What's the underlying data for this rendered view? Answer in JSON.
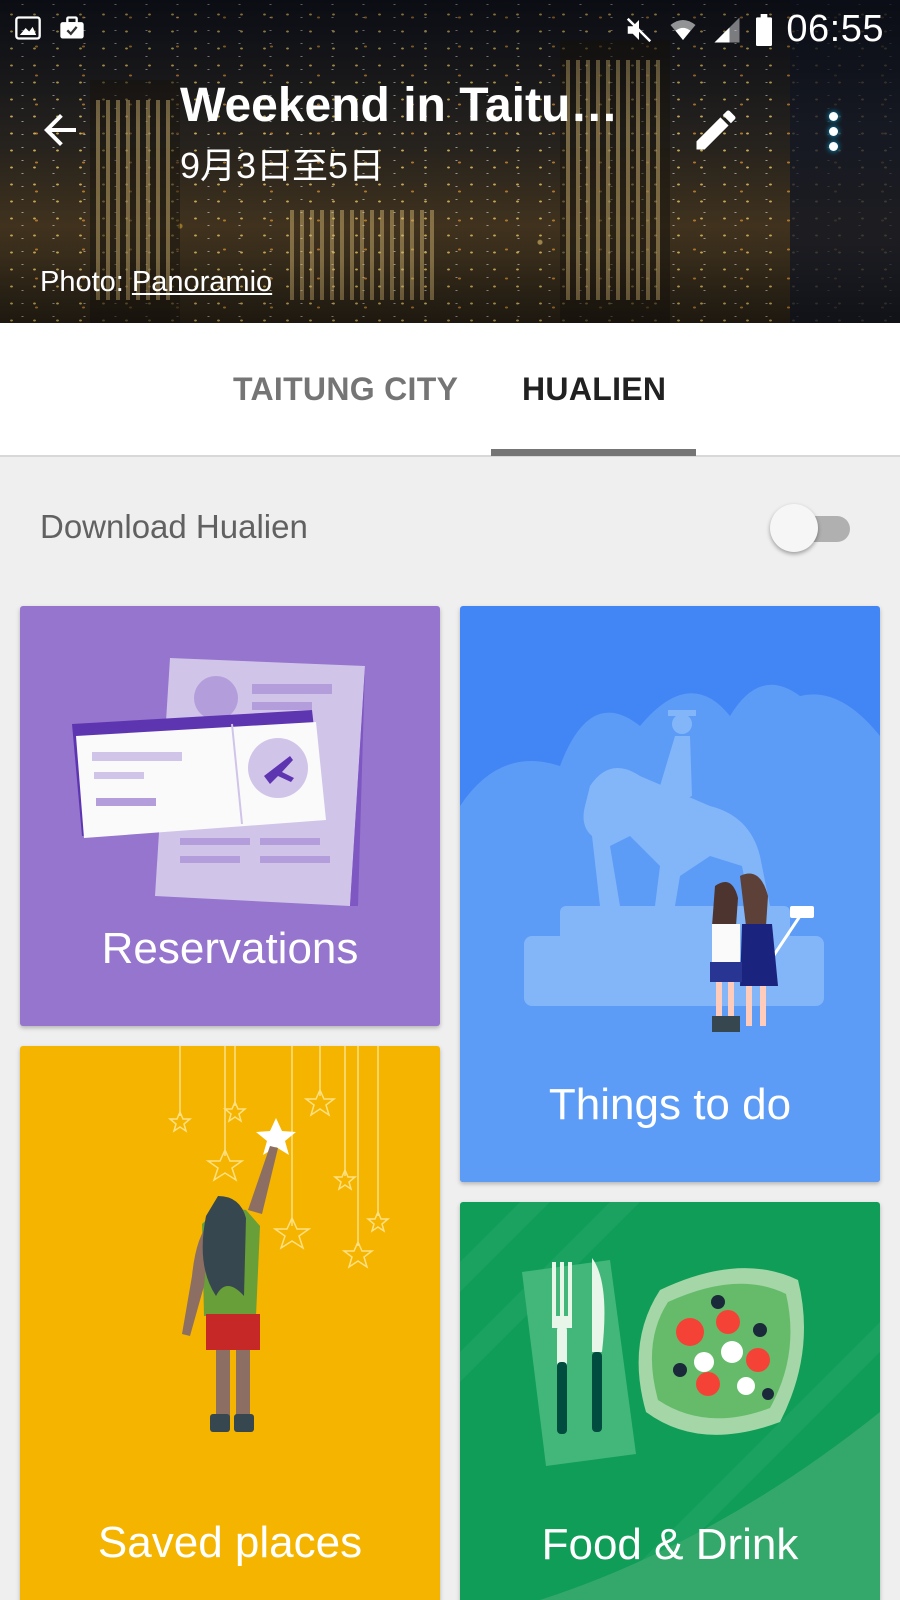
{
  "status_bar": {
    "time": "06:55",
    "left_icons": [
      "image-icon",
      "work-briefcase-icon"
    ],
    "right_icons": [
      "mute-icon",
      "wifi-icon",
      "signal-icon",
      "battery-icon"
    ]
  },
  "header": {
    "title": "Weekend in Taitun…",
    "subtitle": "9月3日至5日",
    "photo_credit_prefix": "Photo: ",
    "photo_credit_link": "Panoramio"
  },
  "tabs": [
    {
      "label": "TAITUNG CITY",
      "selected": false
    },
    {
      "label": "HUALIEN",
      "selected": true
    }
  ],
  "download": {
    "label": "Download Hualien",
    "enabled": false
  },
  "cards": {
    "reservations": {
      "label": "Reservations",
      "color": "#9575cd"
    },
    "things_to_do": {
      "label": "Things to do",
      "color": "#4285f4"
    },
    "saved_places": {
      "label": "Saved places",
      "color": "#f4b400"
    },
    "food_drink": {
      "label": "Food & Drink",
      "color": "#0f9d58"
    }
  }
}
